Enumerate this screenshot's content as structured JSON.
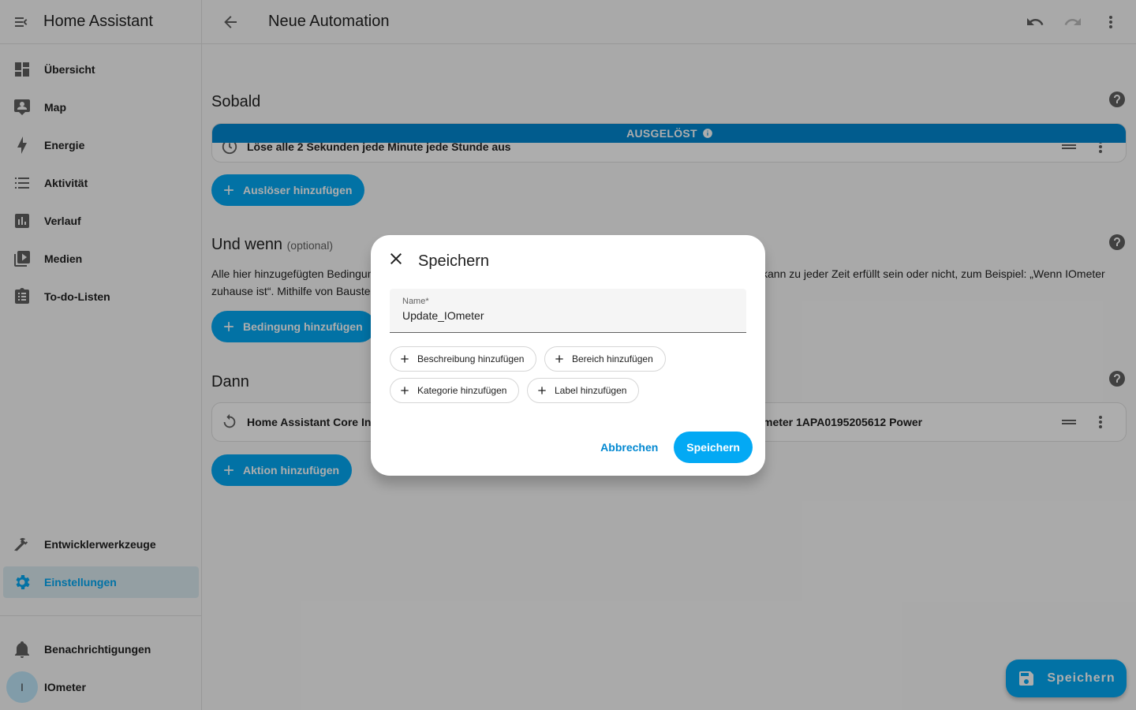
{
  "app": {
    "title": "Home Assistant"
  },
  "sidebar": {
    "items": [
      {
        "label": "Übersicht",
        "icon": "dashboard-icon"
      },
      {
        "label": "Map",
        "icon": "map-account-icon"
      },
      {
        "label": "Energie",
        "icon": "lightning-bolt-icon"
      },
      {
        "label": "Aktivität",
        "icon": "list-icon"
      },
      {
        "label": "Verlauf",
        "icon": "chart-box-icon"
      },
      {
        "label": "Medien",
        "icon": "media-play-icon"
      },
      {
        "label": "To-do-Listen",
        "icon": "clipboard-list-icon"
      }
    ],
    "dev_tools": "Entwicklerwerkzeuge",
    "settings": "Einstellungen",
    "notifications": "Benachrichtigungen",
    "user": {
      "name": "IOmeter",
      "initial": "I"
    }
  },
  "topbar": {
    "title": "Neue Automation"
  },
  "sections": {
    "triggers": {
      "title": "Sobald",
      "triggered_badge": "AUSGELÖST",
      "card_text": "Löse alle 2 Sekunden jede Minute jede Stunde aus",
      "add_button": "Auslöser hinzufügen"
    },
    "conditions": {
      "title": "Und wenn",
      "optional": "(optional)",
      "description_left": "Alle hier hinzugefügten Bedingungen",
      "description_right": "kann zu jeder Zeit erfüllt sein oder nicht, zum Beispiel: „Wenn IOmeter",
      "description_line2": "zuhause ist“. Mithilfe von Bauste",
      "add_button": "Bedingung hinzufügen"
    },
    "actions": {
      "title": "Dann",
      "card_text_left": "Home Assistant Core Inte",
      "card_text_right": "meter 1APA0195205612 Power",
      "add_button": "Aktion hinzufügen"
    }
  },
  "fab": {
    "label": "Speichern"
  },
  "dialog": {
    "title": "Speichern",
    "name_label": "Name*",
    "name_value": "Update_IOmeter",
    "chips": {
      "description": "Beschreibung hinzufügen",
      "area": "Bereich hinzufügen",
      "category": "Kategorie hinzufügen",
      "label": "Label hinzufügen"
    },
    "cancel": "Abbrechen",
    "save": "Speichern"
  },
  "colors": {
    "accent": "#03a9f4",
    "triggered": "#0288d1"
  }
}
